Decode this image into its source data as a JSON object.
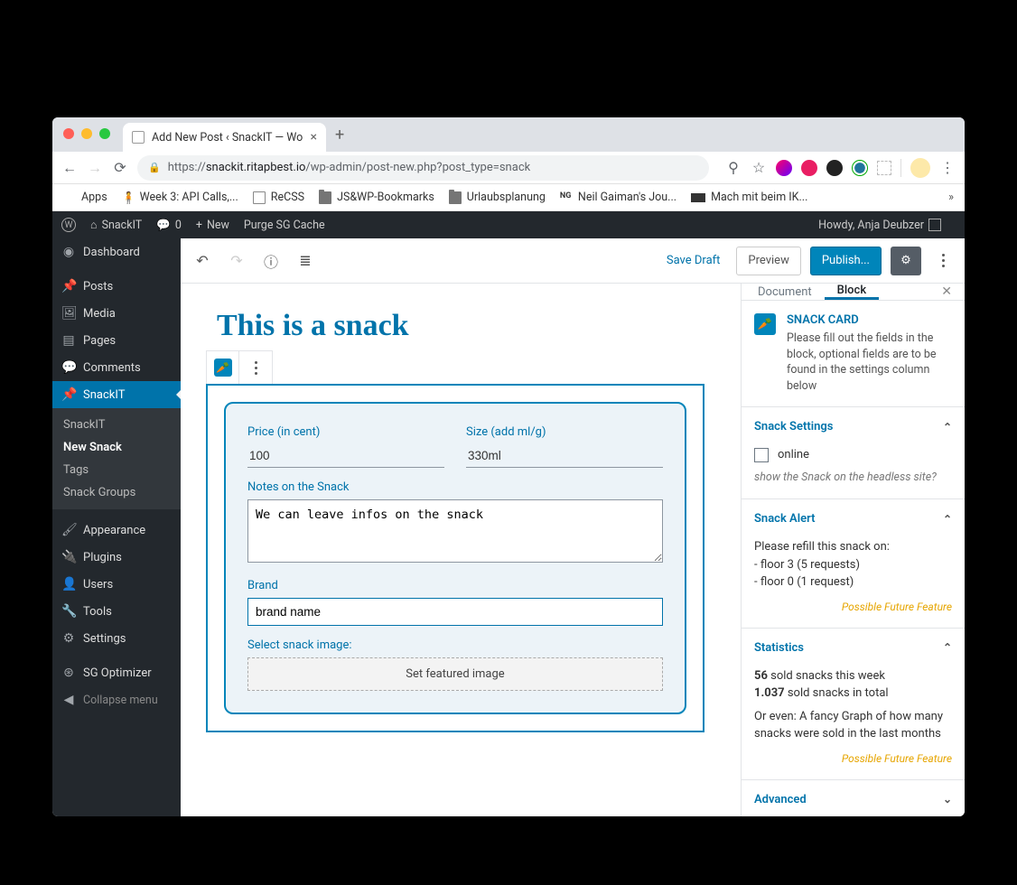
{
  "browser": {
    "tab_title": "Add New Post ‹ SnackIT — Wo",
    "url_prefix": "https://",
    "url_host": "snackit.ritapbest.io",
    "url_path": "/wp-admin/post-new.php?post_type=snack",
    "bookmarks": [
      "Apps",
      "Week 3: API Calls,...",
      "ReCSS",
      "JS&WP-Bookmarks",
      "Urlaubsplanung",
      "Neil Gaiman's Jou...",
      "Mach mit beim IK..."
    ],
    "bookmark_ng": "NG"
  },
  "adminbar": {
    "site": "SnackIT",
    "comments": "0",
    "new": "New",
    "purge": "Purge SG Cache",
    "howdy": "Howdy, Anja Deubzer"
  },
  "sidebar": {
    "items": [
      {
        "label": "Dashboard"
      },
      {
        "label": "Posts"
      },
      {
        "label": "Media"
      },
      {
        "label": "Pages"
      },
      {
        "label": "Comments"
      },
      {
        "label": "SnackIT"
      }
    ],
    "submenu": [
      "SnackIT",
      "New Snack",
      "Tags",
      "Snack Groups"
    ],
    "items2": [
      {
        "label": "Appearance"
      },
      {
        "label": "Plugins"
      },
      {
        "label": "Users"
      },
      {
        "label": "Tools"
      },
      {
        "label": "Settings"
      },
      {
        "label": "SG Optimizer"
      }
    ],
    "collapse": "Collapse menu"
  },
  "toolbar": {
    "save_draft": "Save Draft",
    "preview": "Preview",
    "publish": "Publish..."
  },
  "post": {
    "title": "This is a snack",
    "price_label": "Price (in cent)",
    "price_value": "100",
    "size_label": "Size (add ml/g)",
    "size_value": "330ml",
    "notes_label": "Notes on the Snack",
    "notes_value": "We can leave infos on the snack",
    "brand_label": "Brand",
    "brand_value": "brand name",
    "image_label": "Select snack image:",
    "image_button": "Set featured image"
  },
  "inspector": {
    "tab_document": "Document",
    "tab_block": "Block",
    "block_name": "SNACK CARD",
    "block_desc": "Please fill out the fields in the block, optional fields are to be found in the settings column below",
    "panel_settings": "Snack Settings",
    "online_label": "online",
    "online_hint": "show the Snack on the headless site?",
    "panel_alert": "Snack Alert",
    "alert_intro": "Please refill this snack on:",
    "alert_lines": [
      "- floor 3 (5 requests)",
      "- floor 0 (1 request)"
    ],
    "future": "Possible Future Feature",
    "panel_stats": "Statistics",
    "stats_week_n": "56",
    "stats_week_txt": " sold snacks this week",
    "stats_total_n": "1.037",
    "stats_total_txt": " sold snacks in total",
    "stats_line3": "Or even: A fancy Graph of how many snacks were sold in the last months",
    "panel_advanced": "Advanced"
  }
}
